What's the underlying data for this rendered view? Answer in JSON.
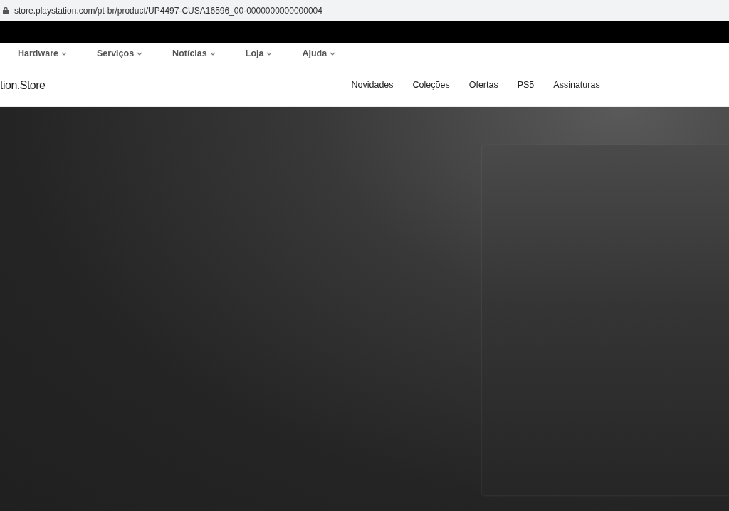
{
  "browser": {
    "url": "store.playstation.com/pt-br/product/UP4497-CUSA16596_00-0000000000000004"
  },
  "top_nav": {
    "items": [
      {
        "label": "Hardware"
      },
      {
        "label": "Serviços"
      },
      {
        "label": "Notícias"
      },
      {
        "label": "Loja"
      },
      {
        "label": "Ajuda"
      }
    ]
  },
  "store_nav": {
    "logo": "tion.Store",
    "items": [
      {
        "label": "Novidades"
      },
      {
        "label": "Coleções"
      },
      {
        "label": "Ofertas"
      },
      {
        "label": "PS5"
      },
      {
        "label": "Assinaturas"
      }
    ]
  }
}
